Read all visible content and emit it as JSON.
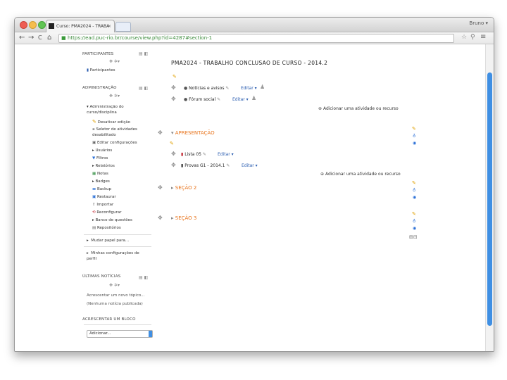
{
  "browser": {
    "tab_title": "Curso: PMA2024 - TRABA",
    "tab_close": "×",
    "profile": "Bruno",
    "url": "https://ead.puc-rio.br/course/view.php?id=4287#section-1",
    "nav": {
      "back": "←",
      "forward": "→",
      "reload": "C",
      "home": "⌂"
    }
  },
  "sidebar": {
    "participants_block": {
      "title": "PARTICIPANTES",
      "link": "Participantes"
    },
    "admin_block": {
      "title": "ADMINISTRAÇÃO",
      "admin_label": "Administração do curso/disciplina",
      "items": [
        "Desativar edição",
        "Seletor de atividades desabilitado",
        "Editar configurações",
        "Usuários",
        "Filtros",
        "Relatórios",
        "Notas",
        "Badges",
        "Backup",
        "Restaurar",
        "Importar",
        "Reconfigurar",
        "Banco de questões",
        "Repositórios"
      ],
      "switch_role": "Mudar papel para...",
      "profile_settings": "Minhas configurações de perfil"
    },
    "news_block": {
      "title": "ÚLTIMAS NOTÍCIAS",
      "add_topic": "Acrescentar um novo tópico...",
      "none": "(Nenhuma notícia publicada)"
    },
    "blog_block": {
      "title": "ACRESCENTAR UM BLOCO",
      "select_value": "Adicionar..."
    }
  },
  "main": {
    "course_title": "PMA2024 - TRABALHO CONCLUSAO DE CURSO - 2014.2",
    "general_activities": [
      {
        "name": "Notícias e avisos",
        "edit": "Editar"
      },
      {
        "name": "Fórum social",
        "edit": "Editar"
      }
    ],
    "add_activity": "Adicionar uma atividade ou recurso",
    "sections": [
      {
        "title": "APRESENTAÇÃO",
        "activities": [
          {
            "name": "Lista 05",
            "edit": "Editar"
          },
          {
            "name": "Provas G1 - 2014.1",
            "edit": "Editar"
          }
        ],
        "add_activity": "Adicionar uma atividade ou recurso"
      },
      {
        "title": "SEÇÃO 2"
      },
      {
        "title": "SEÇÃO 3"
      }
    ]
  },
  "colors": {
    "section_title": "#e8741c",
    "edit_link": "#2a5db0",
    "scroll_thumb": "#3f8fe3"
  }
}
